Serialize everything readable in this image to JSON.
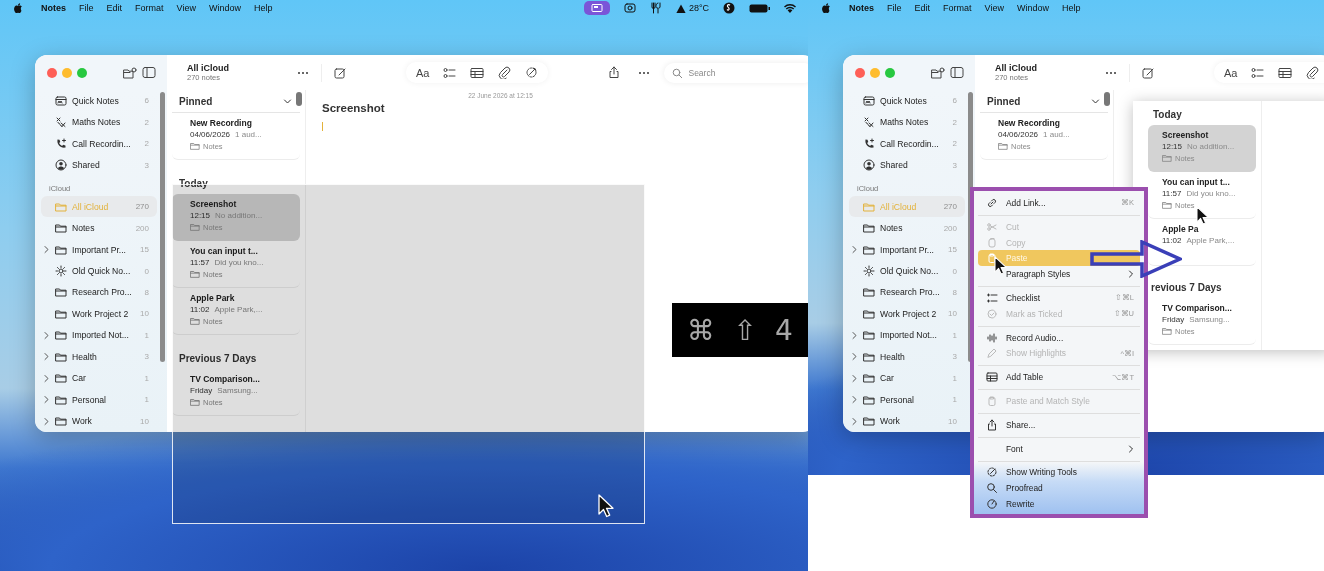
{
  "panels": [
    {
      "kind": "capture",
      "menu_bar": {
        "app_name": "Notes",
        "menus": [
          "File",
          "Edit",
          "Format",
          "View",
          "Window",
          "Help"
        ],
        "temperature": "28°C"
      },
      "window": {
        "folder_title": "All iCloud",
        "note_count": "270 notes",
        "format_button": "Aa",
        "search_placeholder": "Search",
        "sidebar": {
          "items": [
            {
              "label": "Quick Notes",
              "count": "6",
              "kind": "quick_notes",
              "selected": false,
              "expandable": false
            },
            {
              "label": "Maths Notes",
              "count": "2",
              "kind": "maths",
              "selected": false,
              "expandable": false
            },
            {
              "label": "Call Recordin...",
              "count": "2",
              "kind": "calls",
              "selected": false,
              "expandable": false
            },
            {
              "label": "Shared",
              "count": "3",
              "kind": "shared",
              "selected": false,
              "expandable": false
            }
          ],
          "section_label": "iCloud",
          "section_items": [
            {
              "label": "All iCloud",
              "count": "270",
              "kind": "folder",
              "selected": true,
              "expandable": false
            },
            {
              "label": "Notes",
              "count": "200",
              "kind": "folder",
              "selected": false,
              "expandable": false
            },
            {
              "label": "Important Pr...",
              "count": "15",
              "kind": "folder",
              "selected": false,
              "expandable": true
            },
            {
              "label": "Old Quick No...",
              "count": "0",
              "kind": "smart_folder",
              "selected": false,
              "expandable": false
            },
            {
              "label": "Research Pro...",
              "count": "8",
              "kind": "folder",
              "selected": false,
              "expandable": false
            },
            {
              "label": "Work Project 2",
              "count": "10",
              "kind": "folder",
              "selected": false,
              "expandable": false
            },
            {
              "label": "Imported Not...",
              "count": "1",
              "kind": "folder",
              "selected": false,
              "expandable": true
            },
            {
              "label": "Health",
              "count": "3",
              "kind": "folder",
              "selected": false,
              "expandable": true
            },
            {
              "label": "Car",
              "count": "1",
              "kind": "folder",
              "selected": false,
              "expandable": true
            },
            {
              "label": "Personal",
              "count": "1",
              "kind": "folder",
              "selected": false,
              "expandable": true
            },
            {
              "label": "Work",
              "count": "10",
              "kind": "folder",
              "selected": false,
              "expandable": true
            }
          ]
        },
        "note_list": {
          "sections": [
            {
              "title": "Pinned",
              "collapsible": true,
              "notes": [
                {
                  "title": "New Recording",
                  "time": "04/06/2026",
                  "preview": "1 aud...",
                  "folder": "Notes",
                  "selected": false
                }
              ]
            },
            {
              "title": "Today",
              "collapsible": false,
              "notes": [
                {
                  "title": "Screenshot",
                  "time": "12:15",
                  "preview": "No addition...",
                  "folder": "Notes",
                  "selected": true
                },
                {
                  "title": "You can input t...",
                  "time": "11:57",
                  "preview": "Did you kno...",
                  "folder": "Notes",
                  "selected": false
                },
                {
                  "title": "Apple Park",
                  "time": "11:02",
                  "preview": "Apple Park,...",
                  "folder": "Notes",
                  "selected": false
                }
              ]
            },
            {
              "title": "Previous 7 Days",
              "collapsible": false,
              "notes": [
                {
                  "title": "TV Comparison...",
                  "time": "Friday",
                  "preview": "Samsung...",
                  "folder": "Notes",
                  "selected": false
                }
              ]
            }
          ]
        },
        "editor": {
          "date": "22 June 2026 at 12:15",
          "title": "Screenshot"
        }
      },
      "key_overlay": {
        "keys": [
          "⌘",
          "⇧",
          "4"
        ]
      }
    },
    {
      "kind": "paste",
      "menu_bar": {
        "app_name": "Notes",
        "menus": [
          "File",
          "Edit",
          "Format",
          "View",
          "Window",
          "Help"
        ]
      },
      "window": {
        "folder_title": "All iCloud",
        "note_count": "270 notes",
        "format_button": "Aa",
        "sidebar": {
          "items": [
            {
              "label": "Quick Notes",
              "count": "6",
              "kind": "quick_notes",
              "selected": false,
              "expandable": false
            },
            {
              "label": "Maths Notes",
              "count": "2",
              "kind": "maths",
              "selected": false,
              "expandable": false
            },
            {
              "label": "Call Recordin...",
              "count": "2",
              "kind": "calls",
              "selected": false,
              "expandable": false
            },
            {
              "label": "Shared",
              "count": "3",
              "kind": "shared",
              "selected": false,
              "expandable": false
            }
          ],
          "section_label": "iCloud",
          "section_items": [
            {
              "label": "All iCloud",
              "count": "270",
              "kind": "folder",
              "selected": true,
              "expandable": false
            },
            {
              "label": "Notes",
              "count": "200",
              "kind": "folder",
              "selected": false,
              "expandable": false
            },
            {
              "label": "Important Pr...",
              "count": "15",
              "kind": "folder",
              "selected": false,
              "expandable": true
            },
            {
              "label": "Old Quick No...",
              "count": "0",
              "kind": "smart_folder",
              "selected": false,
              "expandable": false
            },
            {
              "label": "Research Pro...",
              "count": "8",
              "kind": "folder",
              "selected": false,
              "expandable": false
            },
            {
              "label": "Work Project 2",
              "count": "10",
              "kind": "folder",
              "selected": false,
              "expandable": false
            },
            {
              "label": "Imported Not...",
              "count": "1",
              "kind": "folder",
              "selected": false,
              "expandable": true
            },
            {
              "label": "Health",
              "count": "3",
              "kind": "folder",
              "selected": false,
              "expandable": true
            },
            {
              "label": "Car",
              "count": "1",
              "kind": "folder",
              "selected": false,
              "expandable": true
            },
            {
              "label": "Personal",
              "count": "1",
              "kind": "folder",
              "selected": false,
              "expandable": true
            },
            {
              "label": "Work",
              "count": "10",
              "kind": "folder",
              "selected": false,
              "expandable": true
            }
          ]
        },
        "note_list": {
          "sections": [
            {
              "title": "Pinned",
              "collapsible": true,
              "notes": [
                {
                  "title": "New Recording",
                  "time": "04/06/2026",
                  "preview": "1 aud...",
                  "folder": "Notes",
                  "selected": false
                }
              ]
            }
          ]
        }
      },
      "snapshot": {
        "sections": [
          {
            "title": "Today",
            "notes": [
              {
                "title": "Screenshot",
                "time": "12:15",
                "preview": "No addition...",
                "folder": "Notes",
                "selected": true
              },
              {
                "title": "You can input t...",
                "time": "11:57",
                "preview": "Did you kno...",
                "folder": "Notes",
                "selected": false
              },
              {
                "title": "Apple Pa",
                "time": "11:02",
                "preview": "Apple Park,...",
                "selected": false
              }
            ]
          },
          {
            "title": "revious 7 Days",
            "notes": [
              {
                "title": "TV Comparison...",
                "time": "Friday",
                "preview": "Samsung...",
                "folder": "Notes",
                "selected": false
              }
            ]
          }
        ]
      },
      "context_menu": {
        "items": [
          {
            "label": "Add Link...",
            "shortcut": "⌘K",
            "disabled": false,
            "selected": false,
            "submenu": false,
            "separator_before": false
          },
          {
            "label": "Cut",
            "disabled": true,
            "selected": false,
            "submenu": false,
            "separator_before": true
          },
          {
            "label": "Copy",
            "disabled": true,
            "selected": false,
            "submenu": false,
            "separator_before": false
          },
          {
            "label": "Paste",
            "disabled": false,
            "selected": true,
            "submenu": false,
            "separator_before": false
          },
          {
            "label": "Paragraph Styles",
            "disabled": false,
            "selected": false,
            "submenu": true,
            "separator_before": false
          },
          {
            "label": "Checklist",
            "shortcut": "⇧⌘L",
            "disabled": false,
            "selected": false,
            "submenu": false,
            "separator_before": true
          },
          {
            "label": "Mark as Ticked",
            "shortcut": "⇧⌘U",
            "disabled": true,
            "selected": false,
            "submenu": false,
            "separator_before": false
          },
          {
            "label": "Record Audio...",
            "disabled": false,
            "selected": false,
            "submenu": false,
            "separator_before": true
          },
          {
            "label": "Show Highlights",
            "shortcut": "^⌘I",
            "disabled": true,
            "selected": false,
            "submenu": false,
            "separator_before": false
          },
          {
            "label": "Add Table",
            "shortcut": "⌥⌘T",
            "disabled": false,
            "selected": false,
            "submenu": false,
            "separator_before": true
          },
          {
            "label": "Paste and Match Style",
            "disabled": true,
            "selected": false,
            "submenu": false,
            "separator_before": true
          },
          {
            "label": "Share...",
            "disabled": false,
            "selected": false,
            "submenu": false,
            "separator_before": true
          },
          {
            "label": "Font",
            "disabled": false,
            "selected": false,
            "submenu": true,
            "separator_before": true
          },
          {
            "label": "Show Writing Tools",
            "disabled": false,
            "selected": false,
            "submenu": false,
            "separator_before": true
          },
          {
            "label": "Proofread",
            "disabled": false,
            "selected": false,
            "submenu": false,
            "separator_before": false
          },
          {
            "label": "Rewrite",
            "disabled": false,
            "selected": false,
            "submenu": false,
            "separator_before": false
          }
        ]
      }
    }
  ]
}
